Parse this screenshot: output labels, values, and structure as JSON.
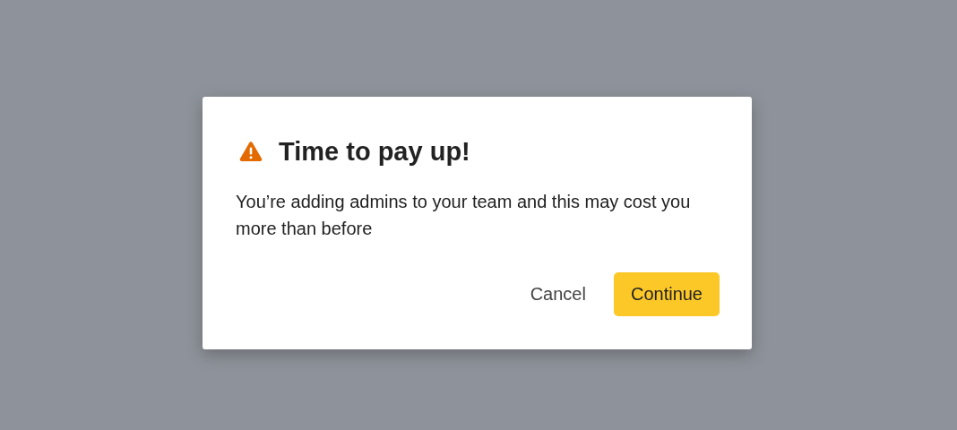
{
  "dialog": {
    "title": "Time to pay up!",
    "message": "You’re adding admins to your team and this may cost you more than before",
    "buttons": [
      {
        "label": "Cancel",
        "kind": "secondary"
      },
      {
        "label": "Continue",
        "kind": "primary"
      }
    ]
  }
}
